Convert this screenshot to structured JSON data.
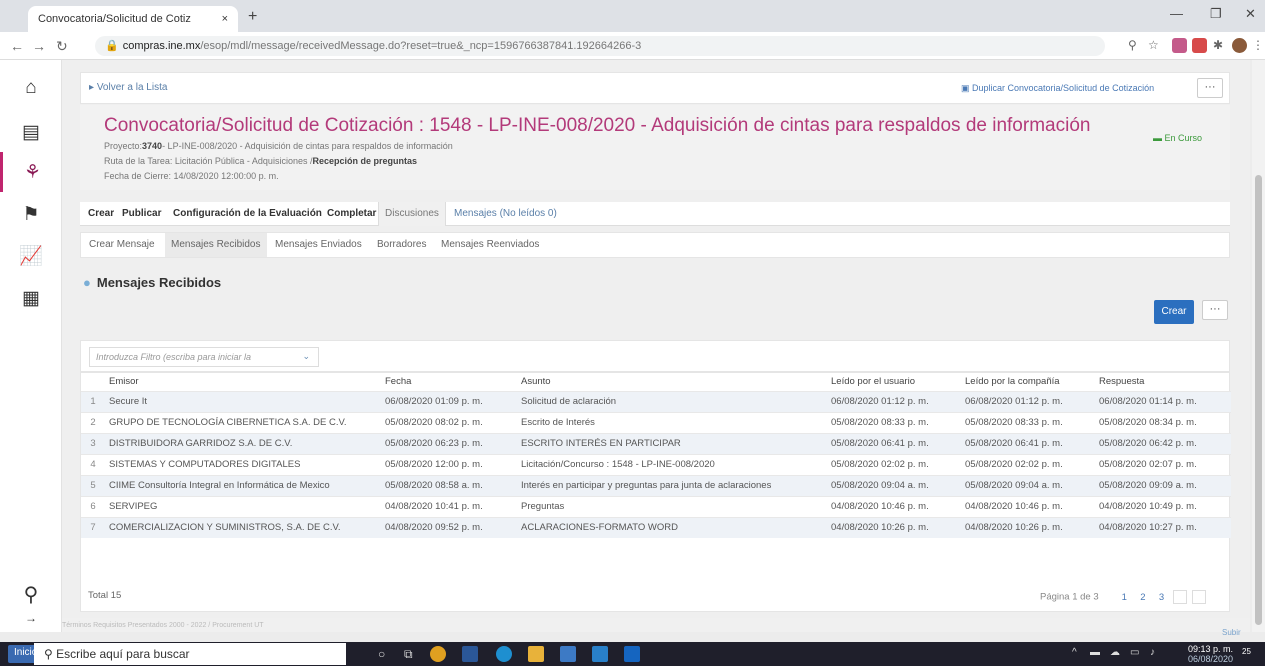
{
  "browser": {
    "tab_title": "Convocatoria/Solicitud de Cotiz",
    "tab_close": "×",
    "new_tab": "+",
    "url_host": "compras.ine.mx",
    "url_path": "/esop/mdl/message/receivedMessage.do?reset=true&_ncp=1596766387841.192664266-3"
  },
  "toolbar": {
    "back_label": "Volver a la Lista",
    "duplicate_label": "Duplicar Convocatoria/Solicitud de Cotización",
    "more_label": "···"
  },
  "header": {
    "title": "Convocatoria/Solicitud de Cotización : 1548 - LP-INE-008/2020 - Adquisición de cintas para respaldos de información",
    "project_label": "Proyecto:",
    "project_value": "3740",
    "project_desc": "- LP-INE-008/2020 - Adquisición de cintas para respaldos de información",
    "route_label": "Ruta de la Tarea: Licitación Pública - Adquisiciones /",
    "route_value": "Recepción de preguntas",
    "close_date": "Fecha de Cierre: 14/08/2020 12:00:00 p. m.",
    "status": "En Curso"
  },
  "main_tabs": [
    "Crear",
    "Publicar",
    "Configuración de la Evaluación",
    "Completar",
    "Discusiones",
    "Mensajes (No leídos 0)"
  ],
  "sub_tabs": [
    "Crear Mensaje",
    "Mensajes Recibidos",
    "Mensajes Enviados",
    "Borradores",
    "Mensajes Reenviados"
  ],
  "section_title": "Mensajes Recibidos",
  "create_button": "Crear",
  "filter_placeholder": "Introduzca Filtro (escriba para iniciar la",
  "table": {
    "headers": [
      "Emisor",
      "Fecha",
      "Asunto",
      "Leído por el usuario",
      "Leído por la compañía",
      "Respuesta"
    ],
    "rows": [
      {
        "n": "1",
        "emisor": "Secure It",
        "fecha": "06/08/2020 01:09 p. m.",
        "asunto": "Solicitud de aclaración",
        "leido_usuario": "06/08/2020 01:12 p. m.",
        "leido_compania": "06/08/2020 01:12 p. m.",
        "respuesta": "06/08/2020 01:14 p. m."
      },
      {
        "n": "2",
        "emisor": "GRUPO DE TECNOLOGÍA CIBERNETICA S.A. DE C.V.",
        "fecha": "05/08/2020 08:02 p. m.",
        "asunto": "Escrito de Interés",
        "leido_usuario": "05/08/2020 08:33 p. m.",
        "leido_compania": "05/08/2020 08:33 p. m.",
        "respuesta": "05/08/2020 08:34 p. m."
      },
      {
        "n": "3",
        "emisor": "DISTRIBUIDORA GARRIDOZ S.A. DE C.V.",
        "fecha": "05/08/2020 06:23 p. m.",
        "asunto": "ESCRITO INTERÉS EN PARTICIPAR",
        "leido_usuario": "05/08/2020 06:41 p. m.",
        "leido_compania": "05/08/2020 06:41 p. m.",
        "respuesta": "05/08/2020 06:42 p. m."
      },
      {
        "n": "4",
        "emisor": "SISTEMAS Y COMPUTADORES DIGITALES",
        "fecha": "05/08/2020 12:00 p. m.",
        "asunto": "Licitación/Concurso : 1548 - LP-INE-008/2020",
        "leido_usuario": "05/08/2020 02:02 p. m.",
        "leido_compania": "05/08/2020 02:02 p. m.",
        "respuesta": "05/08/2020 02:07 p. m."
      },
      {
        "n": "5",
        "emisor": "CIIME Consultoría Integral en Informática de Mexico",
        "fecha": "05/08/2020 08:58 a. m.",
        "asunto": "Interés en participar y preguntas para junta de aclaraciones",
        "leido_usuario": "05/08/2020 09:04 a. m.",
        "leido_compania": "05/08/2020 09:04 a. m.",
        "respuesta": "05/08/2020 09:09 a. m."
      },
      {
        "n": "6",
        "emisor": "SERVIPEG",
        "fecha": "04/08/2020 10:41 p. m.",
        "asunto": "Preguntas",
        "leido_usuario": "04/08/2020 10:46 p. m.",
        "leido_compania": "04/08/2020 10:46 p. m.",
        "respuesta": "04/08/2020 10:49 p. m."
      },
      {
        "n": "7",
        "emisor": "COMERCIALIZACION Y SUMINISTROS, S.A. DE C.V.",
        "fecha": "04/08/2020 09:52 p. m.",
        "asunto": "ACLARACIONES-FORMATO WORD",
        "leido_usuario": "04/08/2020 10:26 p. m.",
        "leido_compania": "04/08/2020 10:26 p. m.",
        "respuesta": "04/08/2020 10:27 p. m."
      }
    ]
  },
  "total_label": "Total 15",
  "pager": {
    "label": "Página 1 de 3",
    "pages": [
      "1",
      "2",
      "3"
    ]
  },
  "footer_text": "Términos Requisitos Presentados 2000 - 2022 / Procurement UT",
  "subir_label": "Subir",
  "taskbar": {
    "start_label": "Inicio",
    "search_placeholder": "Escribe aquí para buscar",
    "time": "09:13 p. m.",
    "date": "06/08/2020",
    "notif_count": "25"
  },
  "icons": {
    "rail": [
      "home-icon",
      "dashboard-icon",
      "sourcing-icon",
      "suppliers-icon",
      "analytics-icon",
      "documents-icon",
      "search-icon",
      "arrow-icon"
    ]
  },
  "colors": {
    "title": "#b33a7a",
    "status": "#3c9a3c",
    "primary": "#2b6fbf"
  }
}
